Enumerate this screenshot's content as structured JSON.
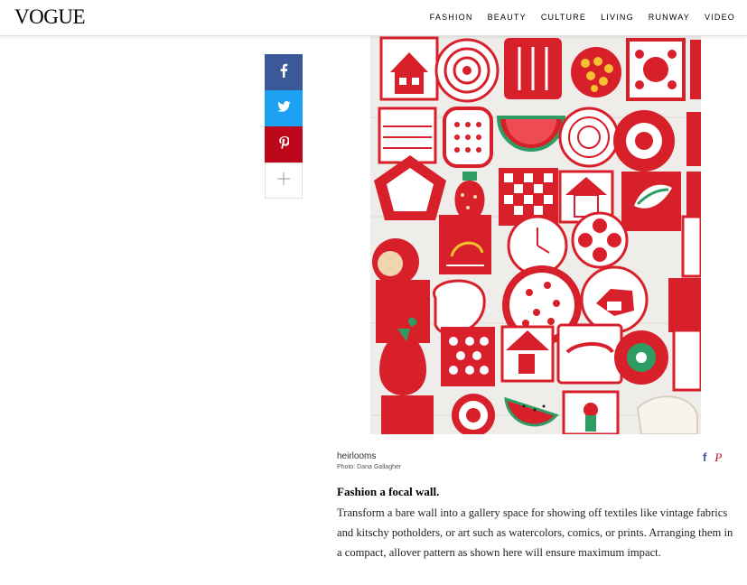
{
  "header": {
    "logo": "VOGUE",
    "nav": [
      "FASHION",
      "BEAUTY",
      "CULTURE",
      "LIVING",
      "RUNWAY",
      "VIDEO"
    ]
  },
  "share": {
    "facebook_icon": "facebook-icon",
    "twitter_icon": "twitter-icon",
    "pinterest_icon": "pinterest-icon",
    "more_icon": "plus-icon"
  },
  "colors": {
    "facebook": "#3b5998",
    "twitter": "#1da1f2",
    "pinterest": "#bd081c",
    "potholder_red": "#d8202b"
  },
  "image": {
    "caption": "heirlooms",
    "credit": "Photo: Dana Gallagher"
  },
  "article": {
    "heading": "Fashion a focal wall.",
    "body": "Transform a bare wall into a gallery space for showing off textiles like vintage fabrics and kitschy potholders, or art such as watercolors, comics, or prints. Arranging them in a compact, allover pattern as shown here will ensure maximum impact."
  }
}
